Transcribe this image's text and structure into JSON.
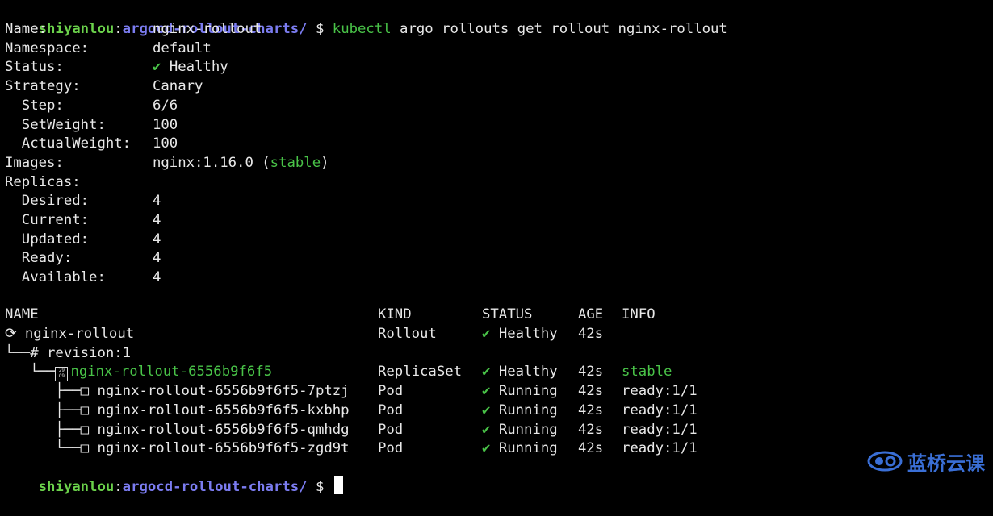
{
  "prompt": {
    "user": "shiyanlou",
    "sep": ":",
    "path": "argocd-rollout-charts/",
    "symbol": "$"
  },
  "command": {
    "program": "kubectl",
    "args": "argo rollouts get rollout nginx-rollout"
  },
  "summary": [
    {
      "key": "Name:",
      "value": "nginx-rollout"
    },
    {
      "key": "Namespace:",
      "value": "default"
    },
    {
      "key": "Status:",
      "check": "✔",
      "value": "Healthy"
    },
    {
      "key": "Strategy:",
      "value": "Canary"
    },
    {
      "key": "  Step:",
      "value": "6/6"
    },
    {
      "key": "  SetWeight:",
      "value": "100"
    },
    {
      "key": "  ActualWeight:",
      "value": "100"
    },
    {
      "key": "Images:",
      "value": "nginx:1.16.0",
      "tag_open": "(",
      "tag": "stable",
      "tag_close": ")"
    },
    {
      "key": "Replicas:",
      "value": ""
    },
    {
      "key": "  Desired:",
      "value": "4"
    },
    {
      "key": "  Current:",
      "value": "4"
    },
    {
      "key": "  Updated:",
      "value": "4"
    },
    {
      "key": "  Ready:",
      "value": "4"
    },
    {
      "key": "  Available:",
      "value": "4"
    }
  ],
  "table": {
    "headers": {
      "name": "NAME",
      "kind": "KIND",
      "status": "STATUS",
      "age": "AGE",
      "info": "INFO"
    },
    "rows": [
      {
        "prefix": "⟳ ",
        "name": "nginx-rollout",
        "kind": "Rollout",
        "check": "✔",
        "status": "Healthy",
        "age": "42s",
        "info": ""
      },
      {
        "prefix": "└──# ",
        "name": "revision:1",
        "kind": "",
        "check": "",
        "status": "",
        "age": "",
        "info": ""
      },
      {
        "prefix": "   └──",
        "icon": "29\nC9",
        "name": "nginx-rollout-6556b9f6f5",
        "kind": "ReplicaSet",
        "check": "✔",
        "status": "Healthy",
        "age": "42s",
        "info": "stable"
      },
      {
        "prefix": "      ├──□ ",
        "name": "nginx-rollout-6556b9f6f5-7ptzj",
        "kind": "Pod",
        "check": "✔",
        "status": "Running",
        "age": "42s",
        "info": "ready:1/1"
      },
      {
        "prefix": "      ├──□ ",
        "name": "nginx-rollout-6556b9f6f5-kxbhp",
        "kind": "Pod",
        "check": "✔",
        "status": "Running",
        "age": "42s",
        "info": "ready:1/1"
      },
      {
        "prefix": "      ├──□ ",
        "name": "nginx-rollout-6556b9f6f5-qmhdg",
        "kind": "Pod",
        "check": "✔",
        "status": "Running",
        "age": "42s",
        "info": "ready:1/1"
      },
      {
        "prefix": "      └──□ ",
        "name": "nginx-rollout-6556b9f6f5-zgd9t",
        "kind": "Pod",
        "check": "✔",
        "status": "Running",
        "age": "42s",
        "info": "ready:1/1"
      }
    ]
  },
  "watermark": {
    "text": "蓝桥云课",
    "icon": "lanqiao-logo-icon"
  },
  "colors": {
    "user": "#6bd24b",
    "path": "#7b7cf0",
    "green": "#49c348",
    "bg": "#000000",
    "text": "#e8e8e8",
    "watermark": "#3a6fd6"
  }
}
